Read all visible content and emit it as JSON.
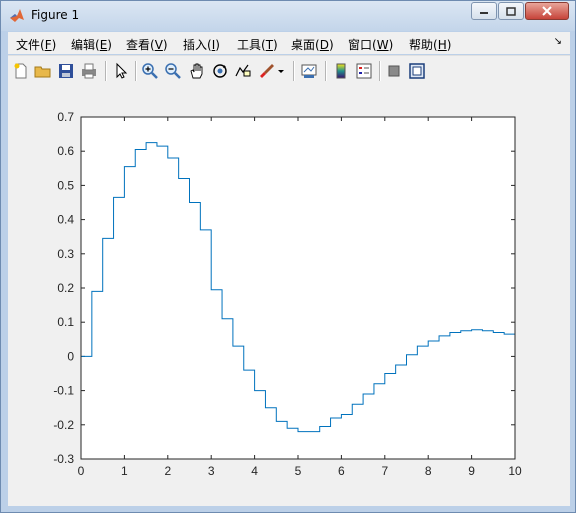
{
  "window": {
    "title": "Figure 1"
  },
  "menu": [
    {
      "label": "文件(",
      "mnemonic": "F",
      "tail": ")"
    },
    {
      "label": "编辑(",
      "mnemonic": "E",
      "tail": ")"
    },
    {
      "label": "查看(",
      "mnemonic": "V",
      "tail": ")"
    },
    {
      "label": "插入(",
      "mnemonic": "I",
      "tail": ")"
    },
    {
      "label": "工具(",
      "mnemonic": "T",
      "tail": ")"
    },
    {
      "label": "桌面(",
      "mnemonic": "D",
      "tail": ")"
    },
    {
      "label": "窗口(",
      "mnemonic": "W",
      "tail": ")"
    },
    {
      "label": "帮助(",
      "mnemonic": "H",
      "tail": ")"
    }
  ],
  "toolbar_icons": [
    "new-figure-icon",
    "open-file-icon",
    "save-icon",
    "print-icon",
    "select-arrow-icon",
    "zoom-in-icon",
    "zoom-out-icon",
    "pan-hand-icon",
    "rotate-3d-icon",
    "data-cursor-icon",
    "brush-icon",
    "link-plot-icon",
    "colorbar-icon",
    "legend-icon",
    "hide-plot-tools-icon",
    "show-plot-tools-icon"
  ],
  "chart_data": {
    "type": "line",
    "style": "stairs",
    "line_color": "#0072bd",
    "xlim": [
      0,
      10
    ],
    "ylim": [
      -0.3,
      0.7
    ],
    "xticks": [
      "0",
      "1",
      "2",
      "3",
      "4",
      "5",
      "6",
      "7",
      "8",
      "9",
      "10"
    ],
    "yticks": [
      "-0.3",
      "-0.2",
      "-0.1",
      "0",
      "0.1",
      "0.2",
      "0.3",
      "0.4",
      "0.5",
      "0.6",
      "0.7"
    ],
    "grid": false,
    "title": "",
    "xlabel": "",
    "ylabel": "",
    "x": [
      0,
      0.25,
      0.5,
      0.75,
      1.0,
      1.25,
      1.5,
      1.75,
      2.0,
      2.25,
      2.5,
      2.75,
      3.0,
      3.25,
      3.5,
      3.75,
      4.0,
      4.25,
      4.5,
      4.75,
      5.0,
      5.25,
      5.5,
      5.75,
      6.0,
      6.25,
      6.5,
      6.75,
      7.0,
      7.25,
      7.5,
      7.75,
      8.0,
      8.25,
      8.5,
      8.75,
      9.0,
      9.25,
      9.5,
      9.75,
      10.0
    ],
    "y": [
      0,
      0.19,
      0.345,
      0.465,
      0.555,
      0.605,
      0.625,
      0.615,
      0.58,
      0.52,
      0.45,
      0.37,
      0.195,
      0.11,
      0.03,
      -0.04,
      -0.1,
      -0.15,
      -0.19,
      -0.21,
      -0.22,
      -0.22,
      -0.205,
      -0.18,
      -0.17,
      -0.14,
      -0.11,
      -0.08,
      -0.05,
      -0.025,
      0.005,
      0.03,
      0.045,
      0.06,
      0.07,
      0.075,
      0.078,
      0.075,
      0.07,
      0.065,
      0.055
    ]
  }
}
